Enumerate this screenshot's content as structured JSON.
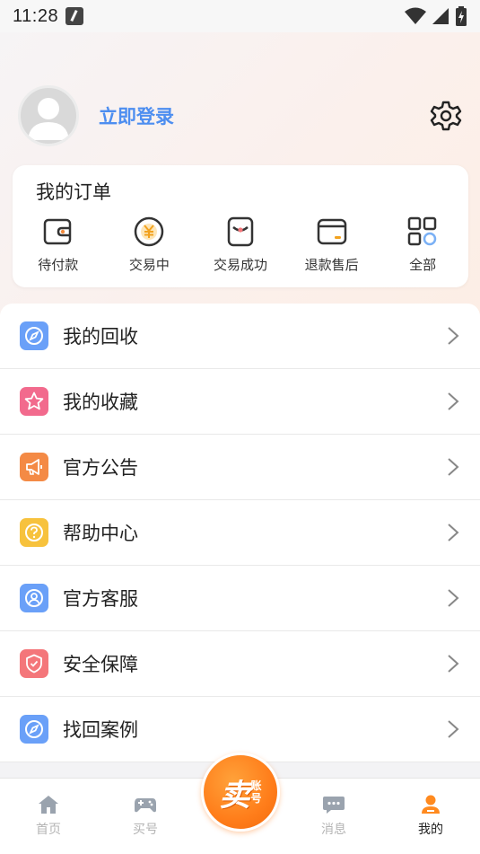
{
  "status_bar": {
    "time": "11:28"
  },
  "profile": {
    "login_label": "立即登录"
  },
  "orders": {
    "title": "我的订单",
    "items": [
      {
        "label": "待付款",
        "icon": "wallet-icon"
      },
      {
        "label": "交易中",
        "icon": "yen-coin-icon"
      },
      {
        "label": "交易成功",
        "icon": "success-box-icon"
      },
      {
        "label": "退款售后",
        "icon": "refund-card-icon"
      },
      {
        "label": "全部",
        "icon": "grid-icon"
      }
    ]
  },
  "menu": {
    "items": [
      {
        "label": "我的回收",
        "icon": "compass-icon",
        "color": "#6aa0f8"
      },
      {
        "label": "我的收藏",
        "icon": "star-icon",
        "color": "#f26a8d"
      },
      {
        "label": "官方公告",
        "icon": "megaphone-icon",
        "color": "#f48a45"
      },
      {
        "label": "帮助中心",
        "icon": "help-icon",
        "color": "#f7c23d"
      },
      {
        "label": "官方客服",
        "icon": "service-icon",
        "color": "#6aa0f8"
      },
      {
        "label": "安全保障",
        "icon": "shield-icon",
        "color": "#f4767a"
      },
      {
        "label": "找回案例",
        "icon": "compass-icon",
        "color": "#6aa0f8"
      }
    ]
  },
  "tabbar": {
    "items": [
      {
        "label": "首页",
        "icon": "home-icon",
        "active": false
      },
      {
        "label": "买号",
        "icon": "gamepad-icon",
        "active": false
      },
      {
        "label": "消息",
        "icon": "message-icon",
        "active": false
      },
      {
        "label": "我的",
        "icon": "user-icon",
        "active": true
      }
    ],
    "sell_button": {
      "main": "卖",
      "sub_top": "账",
      "sub_bottom": "号"
    }
  },
  "colors": {
    "accent": "#4d8ef0",
    "orange": "#ff7d1a"
  }
}
